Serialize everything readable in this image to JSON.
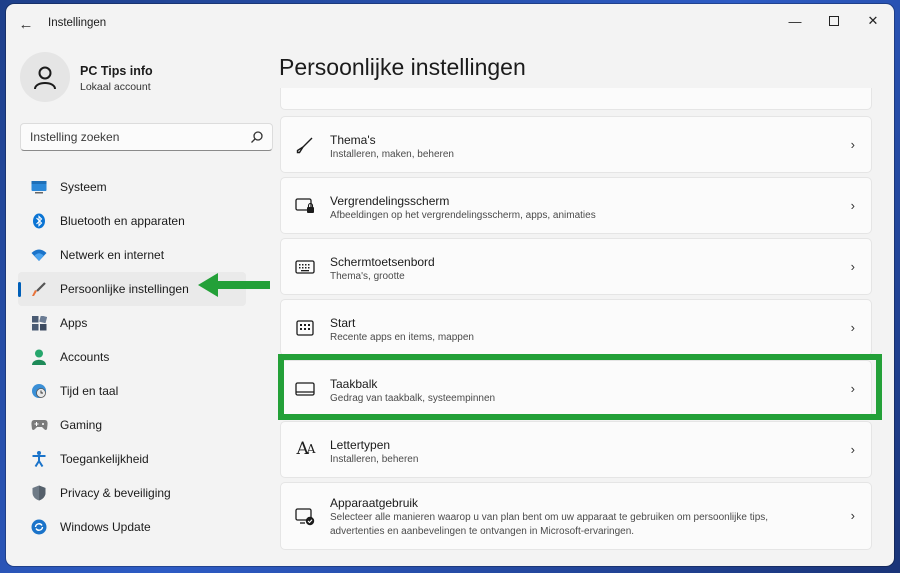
{
  "window": {
    "title": "Instellingen"
  },
  "profile": {
    "name": "PC Tips info",
    "account": "Lokaal account"
  },
  "search": {
    "placeholder": "Instelling zoeken"
  },
  "sidebar": {
    "items": [
      {
        "label": "Systeem",
        "icon": "monitor-icon"
      },
      {
        "label": "Bluetooth en apparaten",
        "icon": "bluetooth-icon"
      },
      {
        "label": "Netwerk en internet",
        "icon": "wifi-icon"
      },
      {
        "label": "Persoonlijke instellingen",
        "icon": "brush-icon",
        "active": true
      },
      {
        "label": "Apps",
        "icon": "apps-icon"
      },
      {
        "label": "Accounts",
        "icon": "person-icon"
      },
      {
        "label": "Tijd en taal",
        "icon": "globe-clock-icon"
      },
      {
        "label": "Gaming",
        "icon": "gamepad-icon"
      },
      {
        "label": "Toegankelijkheid",
        "icon": "accessibility-icon"
      },
      {
        "label": "Privacy & beveiliging",
        "icon": "shield-icon"
      },
      {
        "label": "Windows Update",
        "icon": "update-icon"
      }
    ]
  },
  "main": {
    "title": "Persoonlijke instellingen",
    "cards": [
      {
        "title": "Thema's",
        "subtitle": "Installeren, maken, beheren",
        "icon": "brush-icon"
      },
      {
        "title": "Vergrendelingsscherm",
        "subtitle": "Afbeeldingen op het vergrendelingsscherm, apps, animaties",
        "icon": "lock-screen-icon"
      },
      {
        "title": "Schermtoetsenbord",
        "subtitle": "Thema's, grootte",
        "icon": "keyboard-icon"
      },
      {
        "title": "Start",
        "subtitle": "Recente apps en items, mappen",
        "icon": "start-icon"
      },
      {
        "title": "Taakbalk",
        "subtitle": "Gedrag van taakbalk, systeempinnen",
        "icon": "taskbar-icon"
      },
      {
        "title": "Lettertypen",
        "subtitle": "Installeren, beheren",
        "icon": "font-icon"
      },
      {
        "title": "Apparaatgebruik",
        "subtitle": "Selecteer alle manieren waarop u van plan bent om uw apparaat te gebruiken om persoonlijke tips, advertenties en aanbevelingen te ontvangen in Microsoft-ervaringen.",
        "icon": "device-usage-icon"
      }
    ]
  },
  "colors": {
    "accent": "#005fb8",
    "annotation": "#23a038"
  }
}
